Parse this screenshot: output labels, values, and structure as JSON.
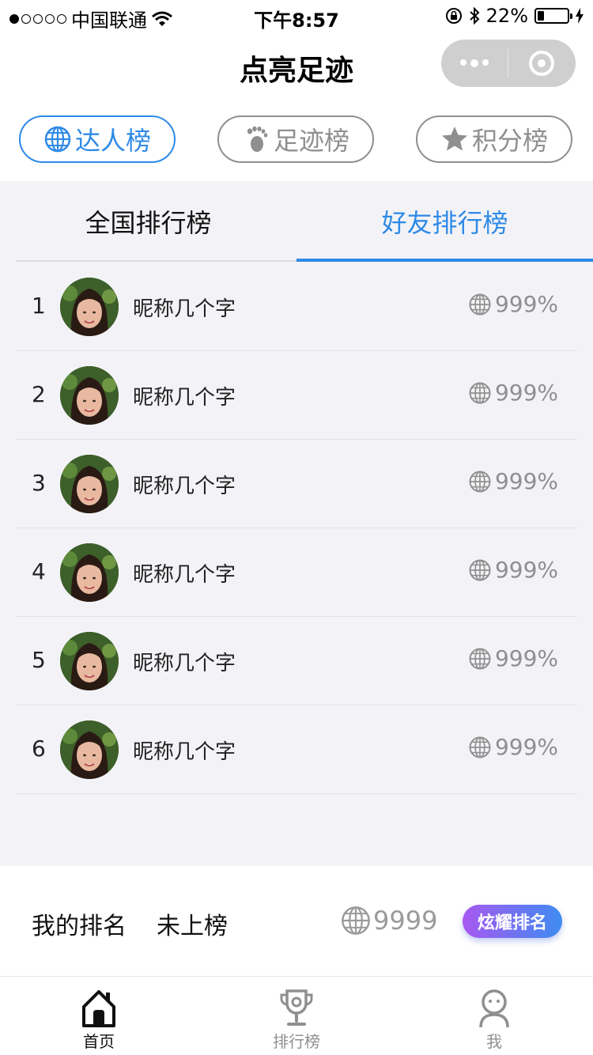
{
  "status_bar": {
    "carrier": "中国联通",
    "time": "下午8:57",
    "battery": "22%",
    "battery_level": 0.22
  },
  "nav": {
    "title": "点亮足迹"
  },
  "categories": [
    {
      "label": "达人榜",
      "icon": "globe-icon",
      "active": true
    },
    {
      "label": "足迹榜",
      "icon": "footprint-icon",
      "active": false
    },
    {
      "label": "积分榜",
      "icon": "star-icon",
      "active": false
    }
  ],
  "tabs": [
    {
      "label": "全国排行榜",
      "active": false
    },
    {
      "label": "好友排行榜",
      "active": true
    }
  ],
  "ranking": [
    {
      "rank": "1",
      "nickname": "昵称几个字",
      "score": "999%"
    },
    {
      "rank": "2",
      "nickname": "昵称几个字",
      "score": "999%"
    },
    {
      "rank": "3",
      "nickname": "昵称几个字",
      "score": "999%"
    },
    {
      "rank": "4",
      "nickname": "昵称几个字",
      "score": "999%"
    },
    {
      "rank": "5",
      "nickname": "昵称几个字",
      "score": "999%"
    },
    {
      "rank": "6",
      "nickname": "昵称几个字",
      "score": "999%"
    }
  ],
  "my_rank": {
    "label": "我的排名",
    "status": "未上榜",
    "score": "9999",
    "button": "炫耀排名"
  },
  "tab_bar": [
    {
      "label": "首页",
      "icon": "home-icon",
      "active": true
    },
    {
      "label": "排行榜",
      "icon": "trophy-icon",
      "active": false
    },
    {
      "label": "我",
      "icon": "user-icon",
      "active": false
    }
  ],
  "colors": {
    "accent": "#2e8ae6",
    "muted": "#8f8f8f",
    "panel_bg": "#f3f3f7",
    "button_gradient_start": "#a758f0",
    "button_gradient_end": "#3e8cf2"
  }
}
